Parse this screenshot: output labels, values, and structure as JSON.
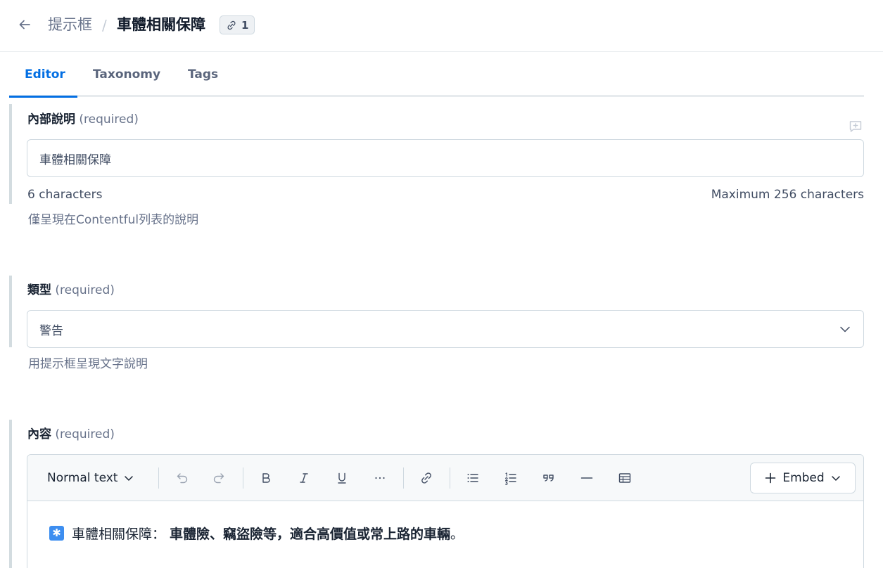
{
  "header": {
    "back_icon": "arrow-left-icon",
    "breadcrumb_parent": "提示框",
    "separator": "/",
    "title": "車體相關保障",
    "reference_count": "1",
    "reference_icon": "link-icon"
  },
  "tabs": [
    {
      "label": "Editor",
      "active": true
    },
    {
      "label": "Taxonomy",
      "active": false
    },
    {
      "label": "Tags",
      "active": false
    }
  ],
  "fields": {
    "internal_description": {
      "label": "內部說明",
      "required": "(required)",
      "value": "車體相關保障",
      "char_count": "6 characters",
      "max_chars": "Maximum 256 characters",
      "help": "僅呈現在Contentful列表的說明"
    },
    "type": {
      "label": "類型",
      "required": "(required)",
      "selected": "警告",
      "help": "用提示框呈現文字說明"
    },
    "content": {
      "label": "內容",
      "required": "(required)",
      "toolbar": {
        "format_select": "Normal text",
        "embed_label": "Embed",
        "tools": [
          "undo-icon",
          "redo-icon",
          "bold-icon",
          "italic-icon",
          "underline-icon",
          "more-formatting-icon",
          "hyperlink-icon",
          "bullet-list-icon",
          "numbered-list-icon",
          "quote-icon",
          "horizontal-rule-icon",
          "table-icon"
        ]
      },
      "body": {
        "emoji": "✳️",
        "prefix": "車體相關保障：",
        "bold_text": "車體險、竊盜險等，適合高價值或常上路的車輛",
        "suffix": "。"
      }
    }
  },
  "colors": {
    "accent": "#036fe3",
    "field_bar": "#d3dce0",
    "border": "#cfd9e0",
    "muted_text": "#67728a"
  }
}
